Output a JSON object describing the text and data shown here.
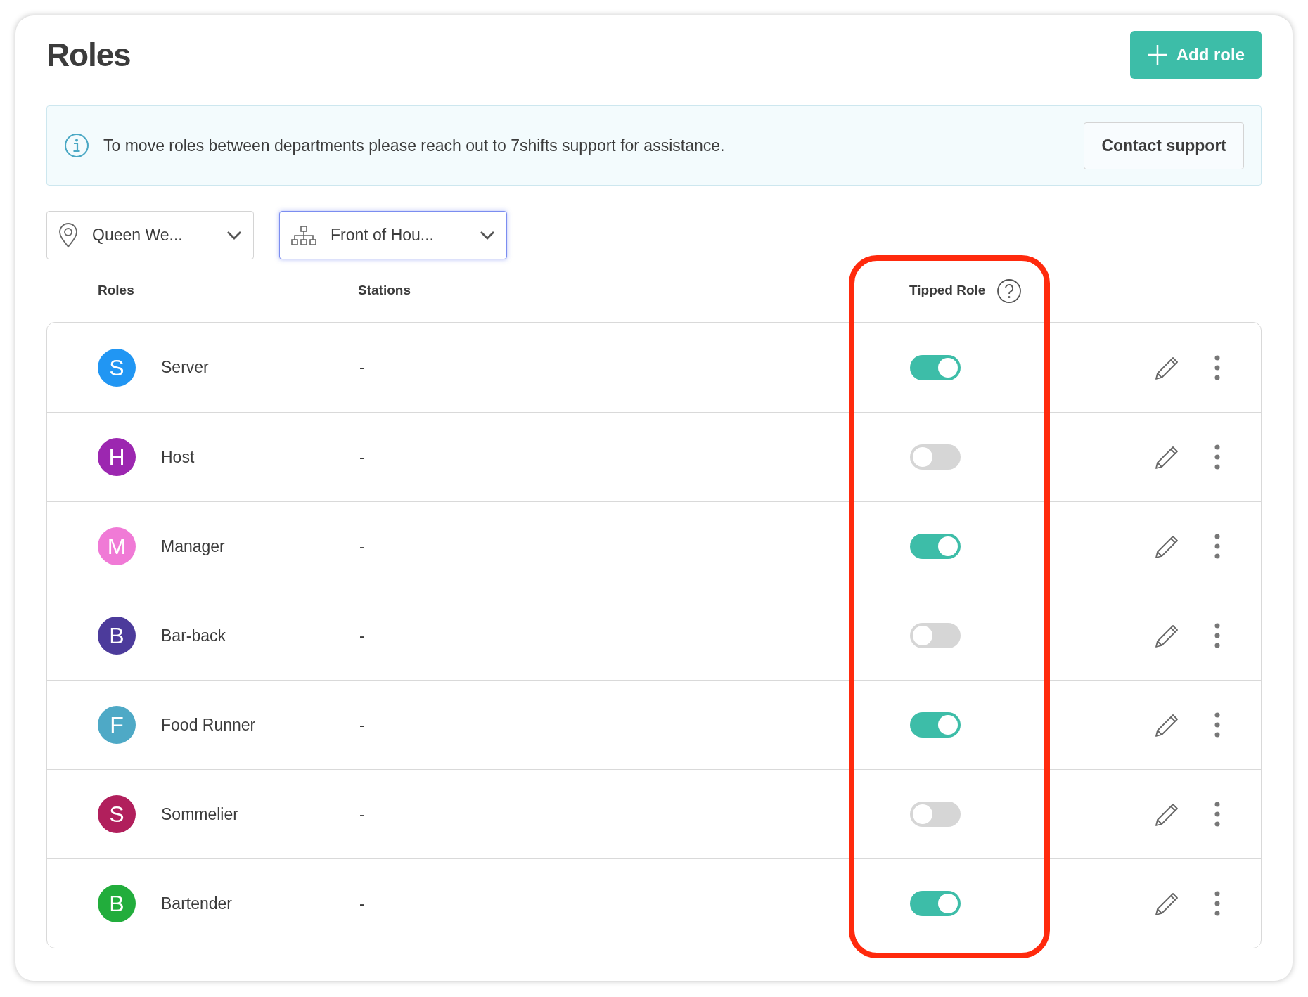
{
  "page": {
    "title": "Roles",
    "add_button": "Add role"
  },
  "notice": {
    "text": "To move roles between departments please reach out to 7shifts support for assistance.",
    "button": "Contact support"
  },
  "filters": [
    {
      "kind": "location",
      "value": "Queen We...",
      "focused": false
    },
    {
      "kind": "department",
      "value": "Front of Hou...",
      "focused": true
    }
  ],
  "table": {
    "columns": [
      "Roles",
      "Stations",
      "Tipped Role"
    ],
    "rows": [
      {
        "initial": "S",
        "name": "Server",
        "stations": "-",
        "color": "#2196f3",
        "tipped": true
      },
      {
        "initial": "H",
        "name": "Host",
        "stations": "-",
        "color": "#9c27b0",
        "tipped": false
      },
      {
        "initial": "M",
        "name": "Manager",
        "stations": "-",
        "color": "#f07ad6",
        "tipped": true
      },
      {
        "initial": "B",
        "name": "Bar-back",
        "stations": "-",
        "color": "#4c3b9b",
        "tipped": false
      },
      {
        "initial": "F",
        "name": "Food Runner",
        "stations": "-",
        "color": "#4ea9c6",
        "tipped": true
      },
      {
        "initial": "S",
        "name": "Sommelier",
        "stations": "-",
        "color": "#b11f5c",
        "tipped": false
      },
      {
        "initial": "B",
        "name": "Bartender",
        "stations": "-",
        "color": "#22ad3c",
        "tipped": true
      }
    ]
  }
}
